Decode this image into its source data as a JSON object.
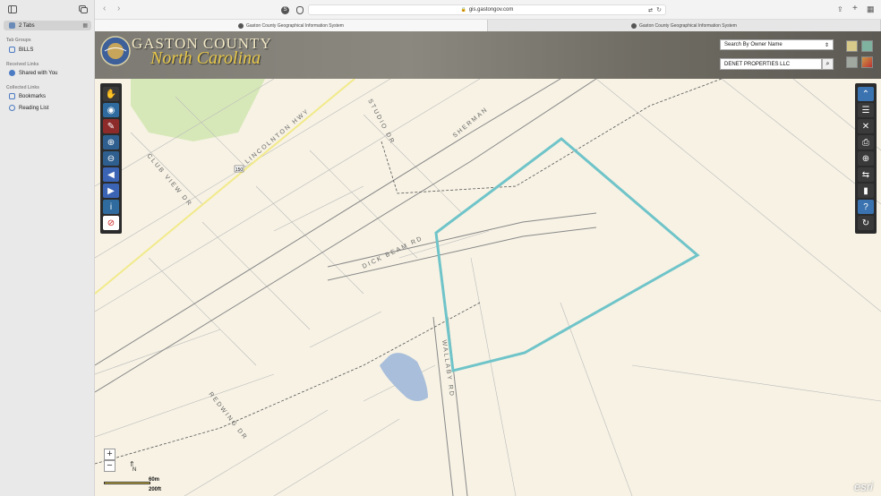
{
  "browser": {
    "url": "gis.gastongov.com",
    "tabs": [
      {
        "label": "Gaston County Geographical Information System",
        "active": true
      },
      {
        "label": "Gaston County Geographical Information System",
        "active": false
      }
    ]
  },
  "sidebar": {
    "tabs_label": "2 Tabs",
    "sections": [
      {
        "heading": "Tab Groups",
        "items": [
          {
            "label": "BILLS",
            "icon": "tab-group-icon"
          }
        ]
      },
      {
        "heading": "Received Links",
        "items": [
          {
            "label": "Shared with You",
            "icon": "shared-icon"
          }
        ]
      },
      {
        "heading": "Collected Links",
        "items": [
          {
            "label": "Bookmarks",
            "icon": "bookmark-icon"
          },
          {
            "label": "Reading List",
            "icon": "reading-list-icon"
          }
        ]
      }
    ]
  },
  "banner": {
    "title": "GASTON COUNTY",
    "subtitle": "North Carolina",
    "search_mode": "Search By Owner Name",
    "search_value": "DENET PROPERTIES LLC"
  },
  "map": {
    "roads": [
      "LINCOLNTON HWY",
      "CLUB VIEW DR",
      "STUDIO DR",
      "SHERMAN",
      "DICK BEAM RD",
      "WALLABY RD",
      "REDWING DR"
    ],
    "route_shield": "150",
    "scale_top": "60m",
    "scale_bottom": "200ft",
    "north_label": "N",
    "attribution": "esri"
  },
  "colors": {
    "parcel_highlight": "#6fc4c9",
    "map_bg": "#f7f2e4",
    "banner_title": "#f3e9c6"
  }
}
